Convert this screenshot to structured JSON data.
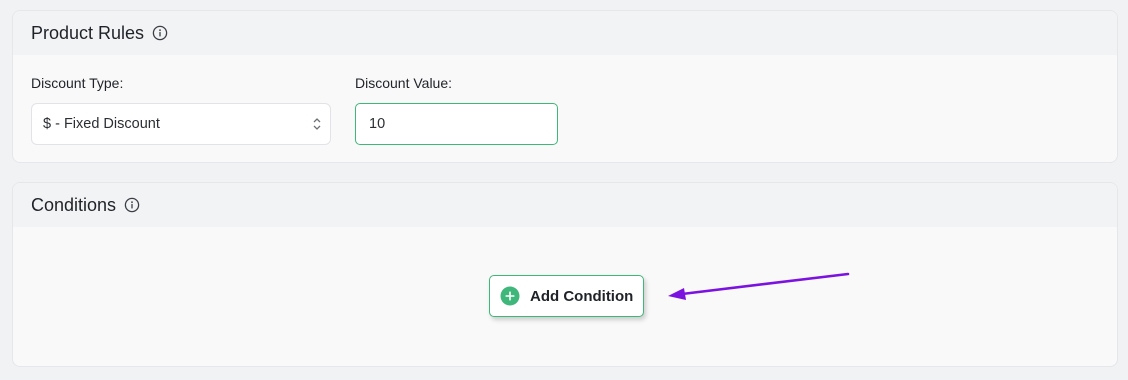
{
  "product_rules": {
    "title": "Product Rules",
    "discount_type_label": "Discount Type:",
    "discount_type_value": "$ - Fixed Discount",
    "discount_value_label": "Discount Value:",
    "discount_value": "10"
  },
  "conditions": {
    "title": "Conditions",
    "add_button_label": "Add Condition"
  },
  "icons": {
    "info": "info-circle-icon",
    "plus": "plus-circle-icon",
    "chevron": "up-down-chevron-icon"
  },
  "colors": {
    "accent_green": "#3fb77a",
    "annotation_arrow": "#7b12e0"
  }
}
